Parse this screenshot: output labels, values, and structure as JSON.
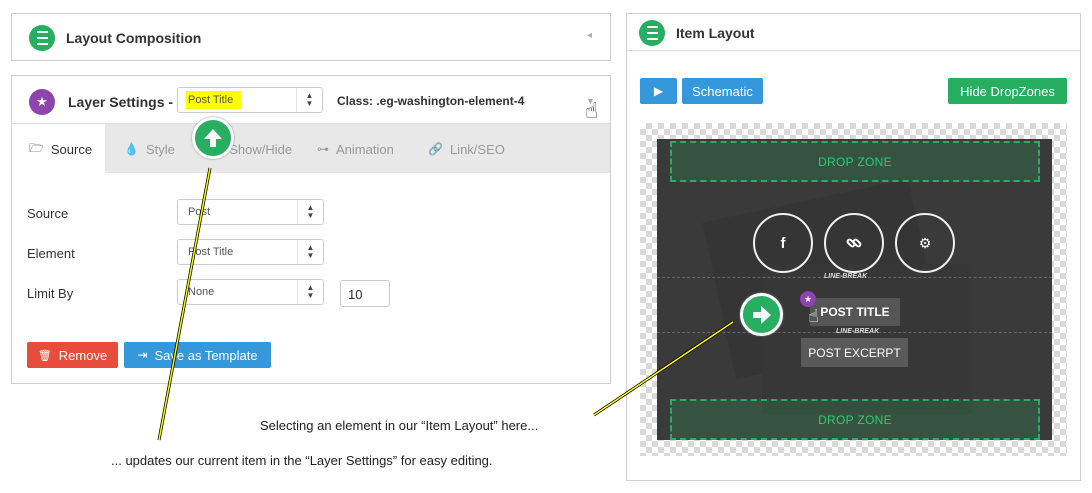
{
  "layout_composition": {
    "title": "Layout Composition",
    "collapse_glyph": "◂"
  },
  "layer_settings": {
    "title": "Layer Settings -",
    "selected_element": "Post Title",
    "class_label": "Class: .eg-washington-element-4",
    "tabs": [
      {
        "label": "Source",
        "icon": "folder-open-icon"
      },
      {
        "label": "Style",
        "icon": "droplet-icon"
      },
      {
        "label": "Show/Hide",
        "icon": "eye-icon"
      },
      {
        "label": "Animation",
        "icon": "toggle-icon"
      },
      {
        "label": "Link/SEO",
        "icon": "link-icon"
      }
    ],
    "fields": {
      "source": {
        "label": "Source",
        "value": "Post"
      },
      "element": {
        "label": "Element",
        "value": "Post Title"
      },
      "limit_by": {
        "label": "Limit By",
        "value": "None",
        "number": "10"
      }
    },
    "buttons": {
      "remove": "Remove",
      "save_template": "Save as Template"
    }
  },
  "item_layout": {
    "title": "Item Layout",
    "buttons": {
      "schematic": "Schematic",
      "hide_dropzones": "Hide DropZones",
      "play_glyph": "▶"
    },
    "canvas": {
      "dropzone_top": "DROP ZONE",
      "dropzone_bottom": "DROP ZONE",
      "social": [
        "f",
        "link",
        "gears"
      ],
      "line_break_1": "LINE-BREAK",
      "line_break_2": "LINE-BREAK",
      "post_title": "POST TITLE",
      "post_excerpt": "POST EXCERPT"
    }
  },
  "annotations": {
    "caption_1": "Selecting an element in our “Item Layout” here...",
    "caption_2": "... updates our current item in the “Layer Settings” for easy editing."
  },
  "colors": {
    "green": "#27ae60",
    "green_button": "#2ecc71",
    "purple": "#8e44ad",
    "blue": "#3498db",
    "red": "#e74c3c",
    "highlight_yellow": "#ffff00",
    "dark_canvas": "#3a3a3a"
  }
}
